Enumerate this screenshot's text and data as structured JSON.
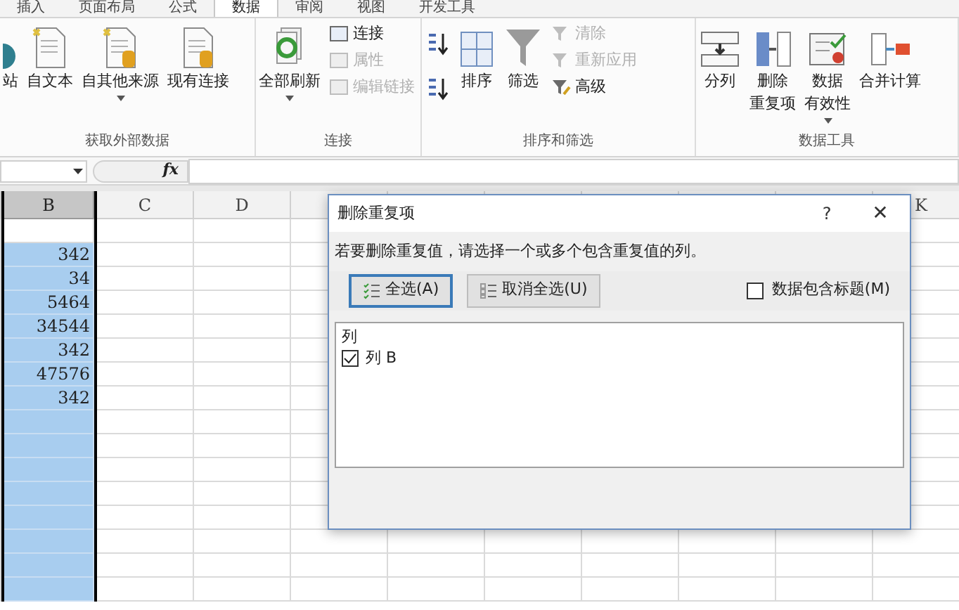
{
  "ribbon_tabs": [
    {
      "label": "插入",
      "selected": false
    },
    {
      "label": "页面布局",
      "selected": false
    },
    {
      "label": "公式",
      "selected": false
    },
    {
      "label": "数据",
      "selected": true
    },
    {
      "label": "审阅",
      "selected": false
    },
    {
      "label": "视图",
      "selected": false
    },
    {
      "label": "开发工具",
      "selected": false
    }
  ],
  "ribbon_groups": [
    {
      "label": "获取外部数据",
      "columns": [
        {
          "kind": "large",
          "lines": [
            "站"
          ],
          "dropdown": false
        },
        {
          "kind": "large",
          "lines": [
            "自文本"
          ],
          "dropdown": false
        },
        {
          "kind": "large",
          "lines": [
            "自其他来源"
          ],
          "dropdown": true
        },
        {
          "kind": "large",
          "lines": [
            "现有连接"
          ],
          "dropdown": false
        }
      ]
    },
    {
      "label": "连接",
      "columns": [
        {
          "kind": "large",
          "lines": [
            "全部刷新"
          ],
          "dropdown": true
        },
        {
          "kind": "stack",
          "items": [
            {
              "label": "连接",
              "disabled": false
            },
            {
              "label": "属性",
              "disabled": true
            },
            {
              "label": "编辑链接",
              "disabled": true
            }
          ]
        }
      ]
    },
    {
      "label": "排序和筛选",
      "columns": [
        {
          "kind": "icons"
        },
        {
          "kind": "large",
          "lines": [
            "排序"
          ],
          "dropdown": false
        },
        {
          "kind": "large",
          "lines": [
            "筛选"
          ],
          "dropdown": false
        },
        {
          "kind": "stack",
          "items": [
            {
              "label": "清除",
              "disabled": true
            },
            {
              "label": "重新应用",
              "disabled": true
            },
            {
              "label": "高级",
              "disabled": false
            }
          ]
        }
      ]
    },
    {
      "label": "数据工具",
      "columns": [
        {
          "kind": "large",
          "lines": [
            "分列"
          ],
          "dropdown": false
        },
        {
          "kind": "large",
          "lines": [
            "删除",
            "重复项"
          ],
          "dropdown": false
        },
        {
          "kind": "large",
          "lines": [
            "数据",
            "有效性"
          ],
          "dropdown": true
        },
        {
          "kind": "large",
          "lines": [
            "合并计算"
          ],
          "dropdown": false
        }
      ]
    }
  ],
  "formula_bar": {
    "function_label": "fx"
  },
  "sheet": {
    "columns": [
      {
        "label": "B",
        "selected": true
      },
      {
        "label": "C",
        "selected": false
      },
      {
        "label": "D",
        "selected": false
      },
      {
        "label": "K",
        "selected": false
      }
    ],
    "column_b_values": [
      "342",
      "34",
      "5464",
      "34544",
      "342",
      "47576",
      "342"
    ]
  },
  "dialog": {
    "title": "删除重复项",
    "help": "?",
    "close": "✕",
    "instruction": "若要删除重复值，请选择一个或多个包含重复值的列。",
    "select_all": "全选(A)",
    "unselect_all": "取消全选(U)",
    "header_checkbox": {
      "label": "数据包含标题(M)",
      "checked": false
    },
    "list_header": "列",
    "columns": [
      {
        "label": "列 B",
        "checked": true
      }
    ]
  }
}
